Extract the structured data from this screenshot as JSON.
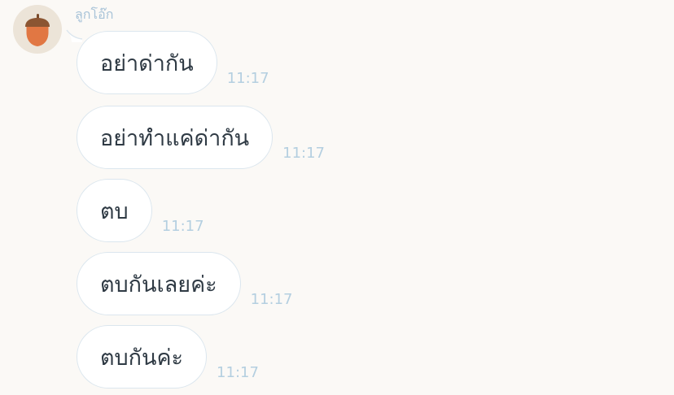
{
  "chat": {
    "sender": {
      "name": "ลูกโอ๊ก",
      "avatar_icon": "acorn-icon",
      "avatar_bg": "#ece4d8"
    },
    "messages": [
      {
        "text": "อย่าด่ากัน",
        "time": "11:17"
      },
      {
        "text": "อย่าทำแค่ด่ากัน",
        "time": "11:17"
      },
      {
        "text": "ตบ",
        "time": "11:17"
      },
      {
        "text": "ตบกันเลยค่ะ",
        "time": "11:17"
      },
      {
        "text": "ตบกันค่ะ",
        "time": "11:17"
      }
    ]
  },
  "colors": {
    "background": "#fbf9f6",
    "bubble_fill": "#ffffff",
    "bubble_border": "#dbe6ee",
    "message_text": "#2f3a44",
    "timestamp": "#b4cfe0",
    "sender_name": "#a8c3d8"
  }
}
